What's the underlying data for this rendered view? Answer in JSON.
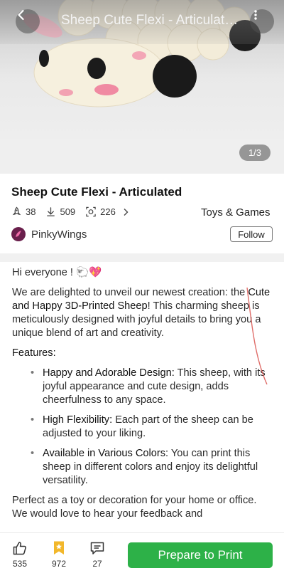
{
  "header": {
    "title": "Sheep Cute Flexi - Articulated",
    "page_indicator": "1/3"
  },
  "model": {
    "title": "Sheep Cute Flexi - Articulated",
    "boosts": "38",
    "downloads": "509",
    "makes": "226",
    "category": "Toys & Games"
  },
  "author": {
    "name": "PinkyWings",
    "follow_label": "Follow"
  },
  "description": {
    "greeting": "Hi everyone ! 🐑💖",
    "intro_start": "We are delighted to unveil our newest creation: the ",
    "intro_highlight": "Cute and Happy 3D-Printed Sheep",
    "intro_end": "! This charming sheep is meticulously designed with joyful details to bring you a unique blend of art and creativity.",
    "features_heading": "Features:",
    "features": [
      {
        "name": "Happy and Adorable Design:",
        "text": " This sheep, with its joyful appearance and cute design, adds cheerfulness to any space."
      },
      {
        "name": "High Flexibility:",
        "text": " Each part of the sheep can be adjusted to your liking."
      },
      {
        "name": "Available in Various Colors:",
        "text": " You can print this sheep in different colors and enjoy its delightful versatility."
      }
    ],
    "closing": "Perfect as a toy or decoration for your home or office. We would love to hear your feedback and"
  },
  "bottom_bar": {
    "likes": "535",
    "collections": "972",
    "comments": "27",
    "print_label": "Prepare to Print"
  },
  "colors": {
    "accent_green": "#2db148",
    "collect_yellow": "#f2b72b"
  }
}
